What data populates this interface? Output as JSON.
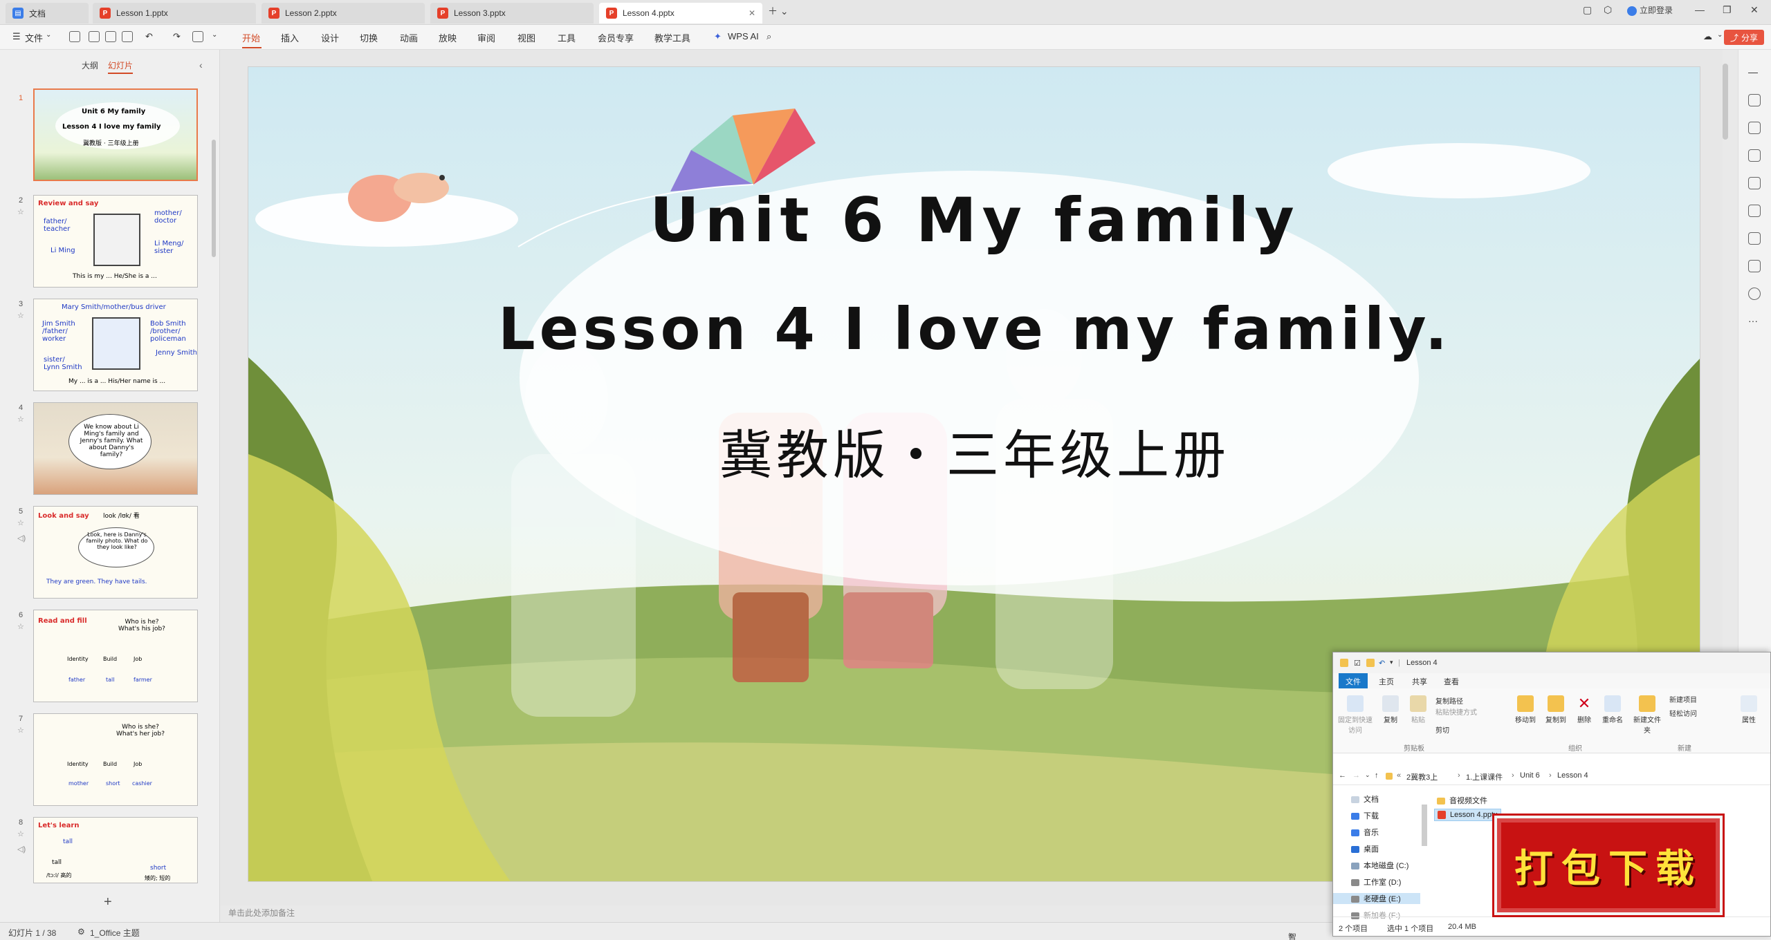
{
  "tabs": [
    {
      "label": "文档",
      "kind": "docs"
    },
    {
      "label": "Lesson 1.pptx",
      "kind": "ppt"
    },
    {
      "label": "Lesson 2.pptx",
      "kind": "ppt"
    },
    {
      "label": "Lesson 3.pptx",
      "kind": "ppt"
    },
    {
      "label": "Lesson 4.pptx",
      "kind": "ppt",
      "active": true
    }
  ],
  "account": {
    "login_label": "立即登录"
  },
  "ribbon": {
    "file_menu": "文件",
    "tabs": [
      "开始",
      "插入",
      "设计",
      "切换",
      "动画",
      "放映",
      "审阅",
      "视图",
      "工具",
      "会员专享",
      "教学工具"
    ],
    "wps_ai": "WPS AI",
    "share": "分享"
  },
  "slide_panel": {
    "tab_outline": "大纲",
    "tab_slides": "幻灯片",
    "thumbs": [
      {
        "num": "1",
        "lines": [
          "Unit 6 My family",
          "Lesson 4 I love my family",
          "冀教版 · 三年级上册"
        ]
      },
      {
        "num": "2",
        "lines": [
          "Review and say",
          "father/ teacher",
          "mother/ doctor",
          "Li Ming",
          "Li Meng/ sister",
          "This is my ... He/She is a ..."
        ]
      },
      {
        "num": "3",
        "lines": [
          "Mary Smith/mother/bus driver",
          "Jim Smith /father/ worker",
          "Bob Smith /brother/ policeman",
          "sister/ Lynn Smith",
          "Jenny Smith",
          "My ... is a ... His/Her name is ..."
        ]
      },
      {
        "num": "4",
        "lines": [
          "We know about Li Ming's family and Jenny's family. What about Danny's family?"
        ]
      },
      {
        "num": "5",
        "lines": [
          "Look and say",
          "look /lʊk/ 看",
          "Look, here is Danny's family photo. What do they look like?",
          "They are green. They have tails."
        ]
      },
      {
        "num": "6",
        "lines": [
          "Read and fill",
          "Who is he? What's his job?",
          "Identity",
          "Build",
          "Job",
          "father",
          "tall",
          "farmer"
        ]
      },
      {
        "num": "7",
        "lines": [
          "Who is she? What's her job?",
          "Identity",
          "Build",
          "Job",
          "mother",
          "short",
          "cashier"
        ]
      },
      {
        "num": "8",
        "lines": [
          "Let's learn",
          "tall",
          "tall",
          "/tɔːl/ 高的",
          "short",
          "矮的; 短的"
        ]
      }
    ]
  },
  "slide": {
    "title": "Unit 6 My family",
    "subtitle": "Lesson 4 I love my family.",
    "edition": "冀教版・三年级上册"
  },
  "notes_placeholder": "单击此处添加备注",
  "status": {
    "slide_count": "幻灯片 1 / 38",
    "theme": "1_Office 主题",
    "smart": "智能美化"
  },
  "explorer": {
    "title": "Lesson 4",
    "tabs": [
      "文件",
      "主页",
      "共享",
      "查看"
    ],
    "buttons": {
      "pin": "固定到快速访问",
      "copy": "复制",
      "paste": "粘贴",
      "copy_path": "复制路径",
      "paste_shortcut": "粘贴快捷方式",
      "cut": "剪切",
      "move_to": "移动到",
      "copy_to": "复制到",
      "delete": "删除",
      "rename": "重命名",
      "new_folder": "新建文件夹",
      "new_item": "新建项目",
      "easy_access": "轻松访问",
      "properties": "属性"
    },
    "groups": {
      "clipboard": "剪贴板",
      "organize": "组织",
      "new": "新建"
    },
    "path": [
      "2冀教3上",
      "1.上课课件",
      "Unit 6",
      "Lesson 4"
    ],
    "nav": [
      "文档",
      "下载",
      "音乐",
      "桌面",
      "本地磁盘 (C:)",
      "工作室 (D:)",
      "老硬盘 (E:)",
      "新加卷 (F:)"
    ],
    "files": [
      "音视频文件",
      "Lesson 4.pptx"
    ],
    "status_items": "2 个项目",
    "status_selected": "选中 1 个项目",
    "status_size": "20.4 MB"
  },
  "download_stamp": "打包下载"
}
